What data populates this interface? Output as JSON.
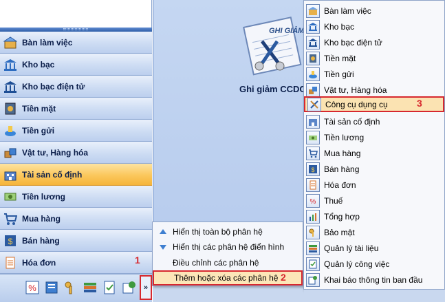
{
  "nav": {
    "items": [
      {
        "label": "Bàn làm việc",
        "icon": "desk-icon",
        "active": false
      },
      {
        "label": "Kho bạc",
        "icon": "treasury-icon",
        "active": false
      },
      {
        "label": "Kho bạc điện tử",
        "icon": "e-treasury-icon",
        "active": false
      },
      {
        "label": "Tiền mặt",
        "icon": "safe-icon",
        "active": false
      },
      {
        "label": "Tiền gửi",
        "icon": "deposit-icon",
        "active": false
      },
      {
        "label": "Vật tư, Hàng hóa",
        "icon": "materials-icon",
        "active": false
      },
      {
        "label": "Tài sản cố định",
        "icon": "fixed-assets-icon",
        "active": true
      },
      {
        "label": "Tiền lương",
        "icon": "salary-icon",
        "active": false
      },
      {
        "label": "Mua hàng",
        "icon": "cart-icon",
        "active": false
      },
      {
        "label": "Bán hàng",
        "icon": "sales-icon",
        "active": false
      },
      {
        "label": "Hóa đơn",
        "icon": "invoice-icon",
        "active": false
      }
    ],
    "toolbar_icons": [
      "tax-icon",
      "reports-icon",
      "keys-icon",
      "books-icon",
      "documents-icon",
      "setup-icon"
    ],
    "chevron": "»"
  },
  "main": {
    "feature_image_label": "GHI GIẢM",
    "feature_title": "Ghi giảm CCDC"
  },
  "step_numbers": {
    "one": "1",
    "two": "2",
    "three": "3"
  },
  "context_menu": {
    "items": [
      {
        "label": "Hiển thị toàn bộ phân hệ",
        "icon": "arrow-up-icon"
      },
      {
        "label": "Hiển thị các phân hệ điển hình",
        "icon": "arrow-down-icon"
      },
      {
        "label": "Điều chỉnh các phân hệ",
        "icon": ""
      },
      {
        "label": "Thêm hoặc xóa các phân hệ",
        "icon": "",
        "highlighted": true
      }
    ]
  },
  "module_menu": {
    "items": [
      {
        "label": "Bàn làm việc"
      },
      {
        "label": "Kho bạc"
      },
      {
        "label": "Kho bạc điện tử"
      },
      {
        "label": "Tiền mặt"
      },
      {
        "label": "Tiền gửi"
      },
      {
        "label": "Vật tư, Hàng hóa"
      },
      {
        "label": "Công cụ dụng cụ",
        "selected": true
      },
      {
        "label": "Tài sản cố định"
      },
      {
        "label": "Tiền lương"
      },
      {
        "label": "Mua hàng"
      },
      {
        "label": "Bán hàng"
      },
      {
        "label": "Hóa đơn"
      },
      {
        "label": "Thuế"
      },
      {
        "label": "Tổng hợp"
      },
      {
        "label": "Bảo mật"
      },
      {
        "label": "Quản lý tài liệu"
      },
      {
        "label": "Quản lý công việc"
      },
      {
        "label": "Khai báo thông tin ban đầu"
      }
    ]
  },
  "colors": {
    "highlight_border": "#d7282e",
    "active_nav": "#fbc75c",
    "selected_item": "#fbe3b2"
  }
}
